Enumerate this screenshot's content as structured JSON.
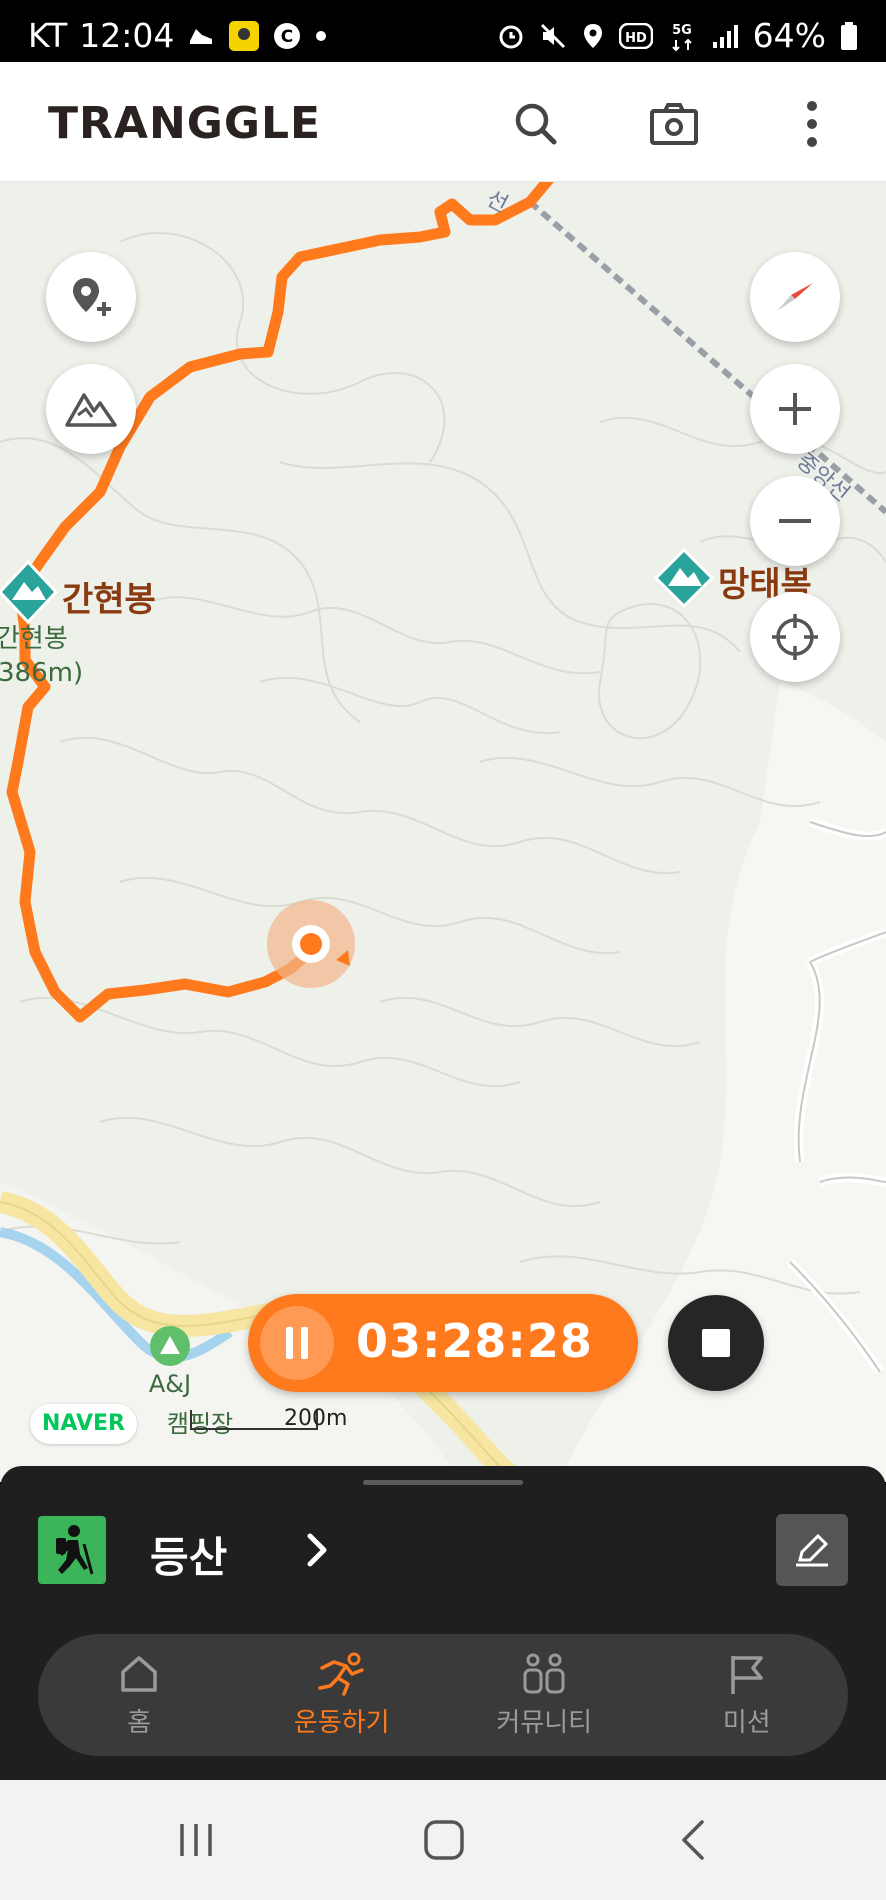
{
  "status_bar": {
    "carrier": "KT",
    "time": "12:04",
    "battery": "64%",
    "network": "5G",
    "hd": "HD"
  },
  "header": {
    "app_name": "TRANGGLE",
    "icons": [
      "search-icon",
      "camera-icon",
      "more-vert-icon"
    ]
  },
  "map": {
    "peaks": [
      {
        "name": "간현봉",
        "sub_name": "간현봉",
        "sub_elevation": "386m)"
      },
      {
        "name": "망태복"
      }
    ],
    "rail_labels": [
      "중앙선",
      "선"
    ],
    "camp": {
      "line1": "A&J",
      "line2": "캠핑장"
    },
    "provider": "NAVER",
    "scale": "200m",
    "route_color": "#ff7a1c"
  },
  "timer": {
    "elapsed": "03:28:28"
  },
  "sheet": {
    "activity": "등산",
    "accent": "#3cb55a"
  },
  "tabs": [
    {
      "label": "홈",
      "icon": "home-icon",
      "active": false
    },
    {
      "label": "운동하기",
      "icon": "running-icon",
      "active": true
    },
    {
      "label": "커뮤니티",
      "icon": "community-icon",
      "active": false
    },
    {
      "label": "미션",
      "icon": "flag-icon",
      "active": false
    }
  ],
  "colors": {
    "accent": "#ff7a1c",
    "sheet_bg": "#1f1f1f",
    "peak_icon": "#2aa39a"
  }
}
